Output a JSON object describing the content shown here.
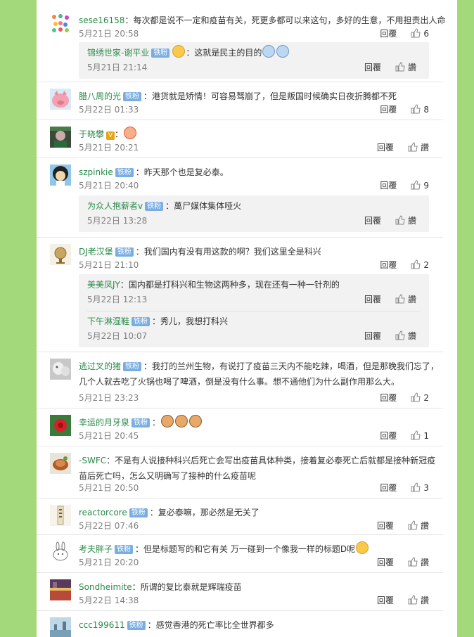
{
  "comments": [
    {
      "user": "sese16158",
      "badge": "",
      "text": "：每次都是说不一定和疫苗有关，死更多都可以来这句，多好的生意，不用担责出人命",
      "time": "5月21日 20:58",
      "reply": "回覆",
      "likes": "6",
      "avatar": "colorful",
      "replies": [
        {
          "user": "锦绣世家-谢平业",
          "badge": "铁粉",
          "text": "：这就是民主的目的",
          "time": "5月21日 21:14",
          "reply": "回覆",
          "likes": "讚",
          "emo_before": [
            "yellow"
          ],
          "emo_after": [
            "blue",
            "blue"
          ]
        }
      ]
    },
    {
      "user": "腊八周的光",
      "badge": "铁粉",
      "text": "：港货就是矫情！可容易驽崩了，但是叛国时候确实日夜折腾都不死",
      "time": "5月22日 01:33",
      "reply": "回覆",
      "likes": "8",
      "avatar": "pig",
      "replies": []
    },
    {
      "user": "于晓攀",
      "badge": "",
      "text": "：",
      "time": "5月21日 20:21",
      "reply": "回覆",
      "likes": "讚",
      "avatar": "dark",
      "verified": "V",
      "emo_after": [
        "red"
      ],
      "replies": []
    },
    {
      "user": "szpinkie",
      "badge": "铁粉",
      "text": "：昨天那个也是复必泰。",
      "time": "5月21日 20:40",
      "reply": "回覆",
      "likes": "9",
      "avatar": "afro",
      "replies": [
        {
          "user": "为众人抱薪者v",
          "badge": "铁粉",
          "text": "：萬尸媒体集体哑火",
          "time": "5月22日 13:28",
          "reply": "回覆",
          "likes": "讚"
        }
      ]
    },
    {
      "user": "DJ老汉堡",
      "badge": "铁粉",
      "text": "：我们国内有没有用这款的啊？我们这里全是科兴",
      "time": "5月21日 21:10",
      "reply": "回覆",
      "likes": "2",
      "avatar": "globe",
      "replies": [
        {
          "user": "美美凤JY",
          "badge": "",
          "text": "：国内都是打科兴和生物这两种多，现在还有一种一针剂的",
          "time": "5月22日 12:13",
          "reply": "回覆",
          "likes": "讚"
        },
        {
          "user": "下午淋湿鞋",
          "badge": "铁粉",
          "text": "：秀儿，我想打科兴",
          "time": "5月22日 10:07",
          "reply": "回覆",
          "likes": "讚"
        }
      ]
    },
    {
      "user": "逃过叉的猪",
      "badge": "铁粉",
      "text": "：我打的兰州生物，有说打了疫苗三天内不能吃辣，喝酒，但是那晚我们忘了，几个人就去吃了火锅也喝了啤酒，倒是没有什么事。想不通他们为什么副作用那么大。",
      "time": "5月21日 23:23",
      "reply": "回覆",
      "likes": "2",
      "avatar": "gray",
      "replies": []
    },
    {
      "user": "幸运的月牙泉",
      "badge": "铁粉",
      "text": "：",
      "time": "5月21日 20:45",
      "reply": "回覆",
      "likes": "1",
      "avatar": "redflower",
      "emo_after": [
        "cat",
        "cat",
        "cat"
      ],
      "replies": []
    },
    {
      "user": "-SWFC",
      "badge": "",
      "text": "：不是有人说接种科兴后死亡会写出疫苗具体种类，接着复必泰死亡后就都是接种新冠疫苗后死亡吗，怎么又明确写了接种的什么疫苗呢",
      "time": "5月21日 20:50",
      "reply": "回覆",
      "likes": "3",
      "avatar": "food",
      "replies": []
    },
    {
      "user": "reactorcore",
      "badge": "铁粉",
      "text": "：复必泰嘛，那必然是无关了",
      "time": "5月22日 07:46",
      "reply": "回覆",
      "likes": "讚",
      "avatar": "scroll",
      "replies": []
    },
    {
      "user": "考夫胖子",
      "badge": "铁粉",
      "text": "：但是标题写的和它有关 万一碰到一个像我一样的标题D呢",
      "time": "5月21日 20:20",
      "reply": "回覆",
      "likes": "讚",
      "avatar": "bunny",
      "emo_after": [
        "yellow"
      ],
      "replies": []
    },
    {
      "user": "Sondheimite",
      "badge": "",
      "text": "：所谓的复比泰就是辉瑞疫苗",
      "time": "5月22日 14:38",
      "reply": "回覆",
      "likes": "讚",
      "avatar": "street",
      "replies": []
    },
    {
      "user": "ccc199611",
      "badge": "铁粉",
      "text": "：感觉香港的死亡率比全世界都多",
      "time": "",
      "reply": "",
      "likes": "",
      "avatar": "sky",
      "replies": []
    }
  ],
  "colors": {
    "name": "#2a8a4a",
    "badge": "#7aaee3",
    "bg": "#a3d97a"
  }
}
